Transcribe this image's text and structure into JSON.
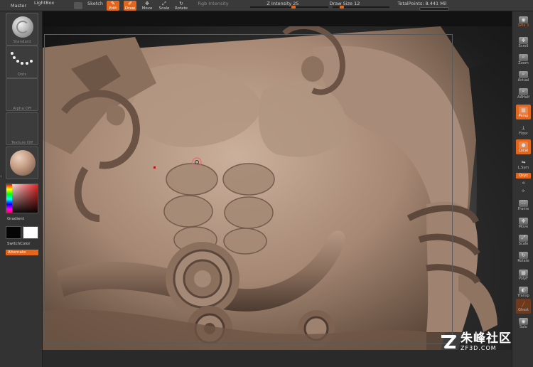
{
  "topbar": {
    "master_label": "Master",
    "lightbox_label": "LightBox",
    "sketch_label": "Sketch",
    "edit_label": "Edit",
    "draw_label": "Draw",
    "move_label": "Move",
    "scale_label": "Scale",
    "rotate_label": "Rotate",
    "rgb_intensity_label": "Rgb Intensity",
    "z_intensity_label": "Z Intensity",
    "z_intensity_value": "25",
    "z_intensity_fraction": 0.25,
    "draw_size_label": "Draw Size",
    "draw_size_value": "12",
    "total_points_label": "TotalPoints:",
    "total_points_value": "8.441 Mil"
  },
  "leftshelf": {
    "brush_label": "Standard",
    "stroke_label": "Dots",
    "alpha_label": "Alpha Off",
    "texture_label": "Texture Off",
    "material_label": "",
    "gradient_label": "Gradient",
    "switchcolor_label": "SwitchColor",
    "alternate_label": "Alternate",
    "primary_color": "#050505",
    "secondary_color": "#ffffff"
  },
  "rightshelf": {
    "spix_label": "SPix",
    "spix_value": "3",
    "scroll_label": "Scroll",
    "zoom_label": "Zoom",
    "actual_label": "Actual",
    "aahalf_label": "AAHalf",
    "persp_label": "Persp",
    "floor_label": "Floor",
    "local_label": "Local",
    "lsym_label": "L.Sym",
    "xyz_label": "Qxyz",
    "frame_label": "Frame",
    "move_label": "Move",
    "scale_label": "Scale",
    "rotate_label": "Rotate",
    "polyf_label": "PolyF",
    "transp_label": "Transp",
    "ghost_label": "Ghost",
    "solo_label": "Solo"
  },
  "colors": {
    "accent": "#e4661d",
    "panel": "#333333",
    "sculpt_clay": "#b79a86"
  },
  "watermark": {
    "cn_text": "朱峰社区",
    "url_text": "ZF3D.COM"
  }
}
